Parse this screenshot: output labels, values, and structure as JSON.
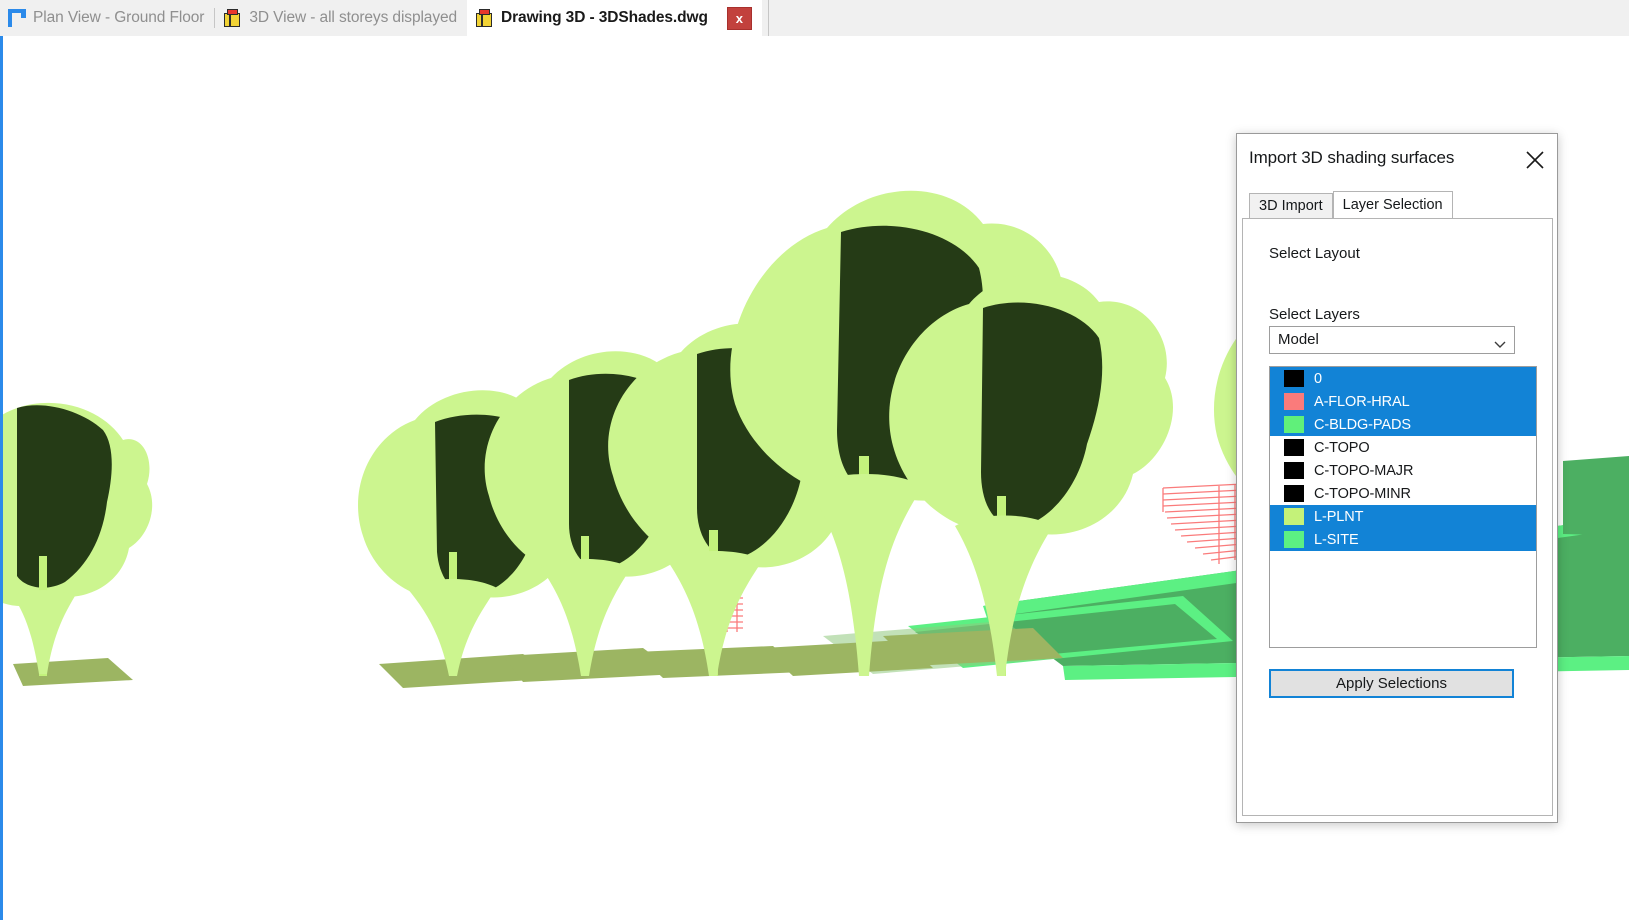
{
  "window": {
    "tabs": [
      {
        "label": "Plan View - Ground Floor",
        "icon": "plan-view-icon",
        "active": false,
        "closable": false
      },
      {
        "label": "3D View - all storeys displayed",
        "icon": "cube-icon",
        "active": false,
        "closable": false
      },
      {
        "label": "Drawing 3D - 3DShades.dwg",
        "icon": "cube-icon",
        "active": true,
        "closable": true
      }
    ],
    "close_label": "x"
  },
  "dialog": {
    "title": "Import 3D shading surfaces",
    "close_icon": "close-icon",
    "tabs": [
      {
        "label": "3D Import",
        "active": false
      },
      {
        "label": "Layer Selection",
        "active": true
      }
    ],
    "select_layout_label": "Select Layout",
    "layout_value": "Model",
    "layout_options": [
      "Model"
    ],
    "select_layers_label": "Select Layers",
    "layers": [
      {
        "name": "0",
        "color": "#000000",
        "selected": true
      },
      {
        "name": "A-FLOR-HRAL",
        "color": "#fa7b7b",
        "selected": true
      },
      {
        "name": "C-BLDG-PADS",
        "color": "#60f07a",
        "selected": true
      },
      {
        "name": "C-TOPO",
        "color": "#000000",
        "selected": false
      },
      {
        "name": "C-TOPO-MAJR",
        "color": "#000000",
        "selected": false
      },
      {
        "name": "C-TOPO-MINR",
        "color": "#000000",
        "selected": false
      },
      {
        "name": "L-PLNT",
        "color": "#c4f279",
        "selected": true
      },
      {
        "name": "L-SITE",
        "color": "#5cf083",
        "selected": true
      }
    ],
    "apply_label": "Apply Selections"
  },
  "viewport": {
    "name": "3d-shading-surfaces-viewport",
    "colors": {
      "background": "#ffffff",
      "foliage_light": "#ccf58f",
      "foliage_dark": "#253b16",
      "trunk": "#c3f27c",
      "ground_mid": "#4caf62",
      "ground_bright": "#5cf083",
      "ground_shadow": "#9cb562",
      "hatch_red": "#fa7b7b",
      "accent_blue": "#2b8aea"
    }
  }
}
